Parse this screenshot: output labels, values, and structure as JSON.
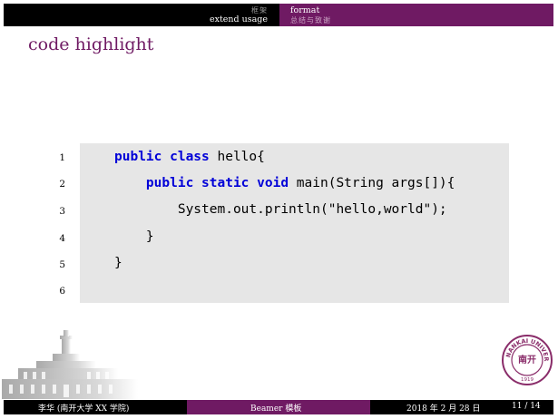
{
  "nav": {
    "left_section_sub": "框架",
    "left_section": "extend usage",
    "right_section": "format",
    "right_section_sub": "总结与致谢"
  },
  "frame": {
    "title": "code highlight"
  },
  "code": {
    "line_numbers": [
      "1",
      "2",
      "3",
      "4",
      "5",
      "6"
    ],
    "lines": [
      {
        "indent": "",
        "kw": "public class",
        "rest": " hello{"
      },
      {
        "indent": "    ",
        "kw": "public static void",
        "rest": " main(String args[]){"
      },
      {
        "indent": "        ",
        "kw": "",
        "rest": "System.out.println(\"hello,world\");"
      },
      {
        "indent": "    ",
        "kw": "",
        "rest": "}"
      },
      {
        "indent": "",
        "kw": "",
        "rest": "}"
      },
      {
        "indent": "",
        "kw": "",
        "rest": ""
      }
    ]
  },
  "seal": {
    "text": "NANKAI UNIVERSITY",
    "year": "1919",
    "center": "南开"
  },
  "footer": {
    "author": "李华 (南开大学 XX 学院)",
    "theme": "Beamer 模板",
    "date": "2018 年 2 月 28 日",
    "page": "11 / 14"
  },
  "colors": {
    "theme_purple": "#6f1a63",
    "keyword_blue": "#0000d8",
    "code_bg": "#e6e6e6"
  }
}
